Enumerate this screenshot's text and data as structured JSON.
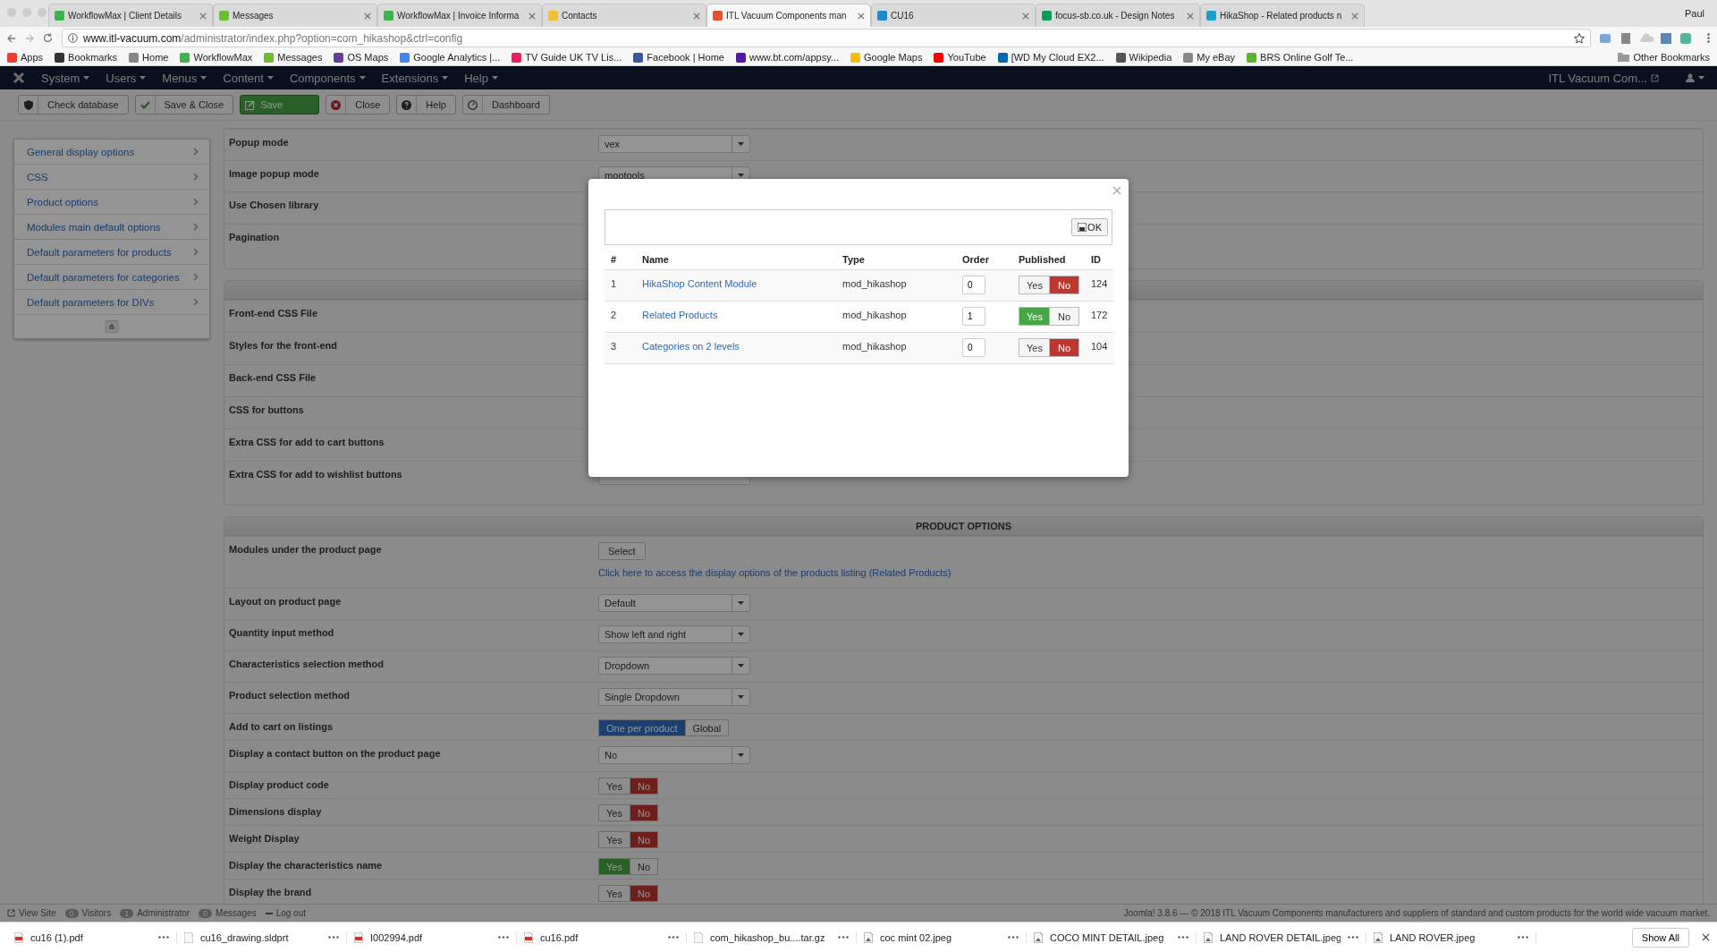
{
  "browser": {
    "tabs": [
      {
        "title": "WorkflowMax | Client Details",
        "selected": false,
        "color": "#3cb44b"
      },
      {
        "title": "Messages",
        "selected": false,
        "color": "#6cbf2c"
      },
      {
        "title": "WorkflowMax | Invoice Informa",
        "selected": false,
        "color": "#3cb44b"
      },
      {
        "title": "Contacts",
        "selected": false,
        "color": "#f2c12e"
      },
      {
        "title": "ITL Vacuum Components man",
        "selected": true,
        "color": "#e8502e"
      },
      {
        "title": "CU16",
        "selected": false,
        "color": "#1f8ad2"
      },
      {
        "title": "focus-sb.co.uk - Design Notes",
        "selected": false,
        "color": "#0f9d58"
      },
      {
        "title": "HikaShop - Related products n",
        "selected": false,
        "color": "#1aa1c9"
      }
    ],
    "profile": "Paul",
    "url": {
      "host": "www.itl-vacuum.com",
      "path": "/administrator/index.php?option=com_hikashop&ctrl=config"
    },
    "bookmarks": [
      {
        "label": "Apps",
        "color": "#e94235"
      },
      {
        "label": "Bookmarks",
        "color": "#333333"
      },
      {
        "label": "Home",
        "color": "#888888"
      },
      {
        "label": "WorkflowMax",
        "color": "#3cb44b"
      },
      {
        "label": "Messages",
        "color": "#6cbf2c"
      },
      {
        "label": "OS Maps",
        "color": "#6a3d9a"
      },
      {
        "label": "Google Analytics |...",
        "color": "#4285f4"
      },
      {
        "label": "TV Guide UK TV Lis...",
        "color": "#e0245e"
      },
      {
        "label": "Facebook | Home",
        "color": "#3b5998"
      },
      {
        "label": "www.bt.com/appsy...",
        "color": "#5514b4"
      },
      {
        "label": "Google Maps",
        "color": "#fbbc05"
      },
      {
        "label": "YouTube",
        "color": "#ff0000"
      },
      {
        "label": "[WD My Cloud EX2...",
        "color": "#0067b1"
      },
      {
        "label": "Wikipedia",
        "color": "#555555"
      },
      {
        "label": "My eBay",
        "color": "#888888"
      },
      {
        "label": "BRS Online Golf Te...",
        "color": "#5cb531"
      }
    ],
    "other_bookmarks": "Other Bookmarks"
  },
  "admin_menu": {
    "items": [
      "System",
      "Users",
      "Menus",
      "Content",
      "Components",
      "Extensions",
      "Help"
    ],
    "site_link": "ITL Vacuum Com..."
  },
  "toolbar": [
    {
      "label": "Check database",
      "kind": "shield",
      "primary": false
    },
    {
      "label": "Save & Close",
      "kind": "check",
      "primary": false
    },
    {
      "label": "Save",
      "kind": "save",
      "primary": true
    },
    {
      "label": "Close",
      "kind": "close",
      "primary": false
    },
    {
      "label": "Help",
      "kind": "help",
      "primary": false
    },
    {
      "label": "Dashboard",
      "kind": "dashboard",
      "primary": false
    }
  ],
  "sidebar": {
    "items": [
      "General display options",
      "CSS",
      "Product options",
      "Modules main default options",
      "Default parameters for products",
      "Default parameters for categories",
      "Default parameters for DIVs"
    ]
  },
  "sections": [
    {
      "rows": [
        {
          "label": "Popup mode",
          "kind": "select",
          "value": "vex"
        },
        {
          "label": "Image popup mode",
          "kind": "select",
          "value": "mootools"
        },
        {
          "label": "Use Chosen library",
          "kind": "none"
        },
        {
          "label": "Pagination",
          "kind": "none"
        }
      ]
    },
    {
      "header": true,
      "rows": [
        {
          "label": "Front-end CSS File",
          "kind": "none"
        },
        {
          "label": "Styles for the front-end",
          "kind": "none"
        },
        {
          "label": "Back-end CSS File",
          "kind": "none"
        },
        {
          "label": "CSS for buttons",
          "kind": "none"
        },
        {
          "label": "Extra CSS for add to cart buttons",
          "kind": "none"
        },
        {
          "label": "Extra CSS for add to wishlist buttons",
          "kind": "input"
        }
      ]
    },
    {
      "header": true,
      "title": "PRODUCT OPTIONS",
      "rows": [
        {
          "label": "Modules under the product page",
          "kind": "button",
          "button": "Select",
          "link": "Click here to access the display options of the products listing (Related Products)"
        },
        {
          "label": "Layout on product page",
          "kind": "select",
          "value": "Default"
        },
        {
          "label": "Quantity input method",
          "kind": "select",
          "value": "Show left and right"
        },
        {
          "label": "Characteristics selection method",
          "kind": "select",
          "value": "Dropdown"
        },
        {
          "label": "Product selection method",
          "kind": "select",
          "value": "Single Dropdown"
        },
        {
          "label": "Add to cart on listings",
          "kind": "choice",
          "options": [
            {
              "label": "One per product",
              "selected": true
            },
            {
              "label": "Global",
              "selected": false
            }
          ]
        },
        {
          "label": "Display a contact button on the product page",
          "kind": "select",
          "value": "No"
        },
        {
          "label": "Display product code",
          "kind": "yesno",
          "options": [
            {
              "label": "Yes",
              "selected": false
            },
            {
              "label": "No",
              "selected": true
            }
          ]
        },
        {
          "label": "Dimensions display",
          "kind": "yesno",
          "options": [
            {
              "label": "Yes",
              "selected": false
            },
            {
              "label": "No",
              "selected": true
            }
          ]
        },
        {
          "label": "Weight Display",
          "kind": "yesno",
          "options": [
            {
              "label": "Yes",
              "selected": false
            },
            {
              "label": "No",
              "selected": true
            }
          ]
        },
        {
          "label": "Display the characteristics name",
          "kind": "yesno",
          "options": [
            {
              "label": "Yes",
              "selected": true
            },
            {
              "label": "No",
              "selected": false
            }
          ]
        },
        {
          "label": "Display the brand",
          "kind": "yesno",
          "options": [
            {
              "label": "Yes",
              "selected": false
            },
            {
              "label": "No",
              "selected": true
            }
          ]
        }
      ]
    }
  ],
  "modal": {
    "ok_button": "OK",
    "columns": [
      "#",
      "Name",
      "Type",
      "Order",
      "Published",
      "ID"
    ],
    "rows": [
      {
        "num": "1",
        "name": "HikaShop Content Module",
        "type": "mod_hikashop",
        "order": "0",
        "published": [
          {
            "label": "Yes",
            "selected": false
          },
          {
            "label": "No",
            "selected": true
          }
        ],
        "id": "124"
      },
      {
        "num": "2",
        "name": "Related Products",
        "type": "mod_hikashop",
        "order": "1",
        "published": [
          {
            "label": "Yes",
            "selected": true
          },
          {
            "label": "No",
            "selected": false
          }
        ],
        "id": "172"
      },
      {
        "num": "3",
        "name": "Categories on 2 levels",
        "type": "mod_hikashop",
        "order": "0",
        "published": [
          {
            "label": "Yes",
            "selected": false
          },
          {
            "label": "No",
            "selected": true
          }
        ],
        "id": "104"
      }
    ]
  },
  "status_bar": {
    "items": [
      {
        "kind": "link",
        "label": "View Site"
      },
      {
        "kind": "count",
        "count": "0",
        "label": "Visitors"
      },
      {
        "kind": "count",
        "count": "1",
        "label": "Administrator"
      },
      {
        "kind": "count",
        "count": "0",
        "label": "Messages"
      },
      {
        "kind": "logout",
        "label": "Log out"
      }
    ],
    "footer": "Joomla! 3.8.6 — © 2018 ITL Vacuum Components manufacturers and suppliers of standard and custom products for the world wide vacuum market."
  },
  "downloads": {
    "items": [
      {
        "name": "cu16 (1).pdf",
        "kind": "pdf"
      },
      {
        "name": "cu16_drawing.sldprt",
        "kind": "file"
      },
      {
        "name": "I002994.pdf",
        "kind": "pdf"
      },
      {
        "name": "cu16.pdf",
        "kind": "pdf"
      },
      {
        "name": "com_hikashop_bu....tar.gz",
        "kind": "file"
      },
      {
        "name": "coc mint 02.jpeg",
        "kind": "image"
      },
      {
        "name": "COCO MINT DETAIL.jpeg",
        "kind": "image"
      },
      {
        "name": "LAND ROVER DETAIL.jpeg",
        "kind": "image"
      },
      {
        "name": "LAND ROVER.jpeg",
        "kind": "image"
      }
    ],
    "show_all": "Show All"
  }
}
